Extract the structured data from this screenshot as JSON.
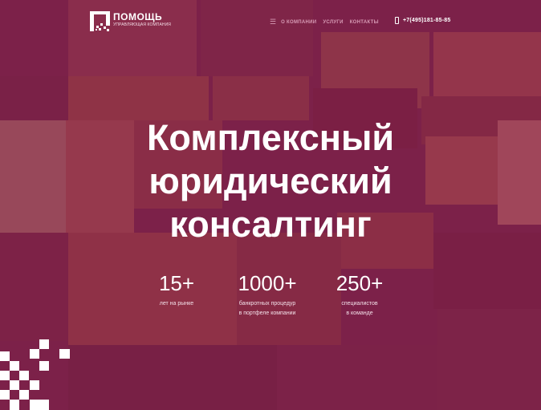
{
  "logo": {
    "name": "ПОМОЩЬ",
    "subtitle": "УПРАВЛЯЮЩАЯ КОМПАНИЯ",
    "icon": "logo-mark-icon"
  },
  "nav": {
    "menu_icon": "menu-icon",
    "items": [
      "О КОМПАНИИ",
      "УСЛУГИ",
      "КОНТАКТЫ"
    ]
  },
  "contact": {
    "phone": "+7(495)181-85-85",
    "icon": "phone-icon"
  },
  "hero": {
    "title_lines": [
      "Комплексный",
      "юридический",
      "консалтинг"
    ]
  },
  "stats": [
    {
      "value": "15+",
      "label_lines": [
        "лет на рынке"
      ]
    },
    {
      "value": "1000+",
      "label_lines": [
        "банкротных процедур",
        "в портфеле компании"
      ]
    },
    {
      "value": "250+",
      "label_lines": [
        "специалистов",
        "в команде"
      ]
    }
  ],
  "colors": {
    "background": "#7a2048",
    "nav_text": "#d79bb5",
    "text": "#ffffff"
  }
}
